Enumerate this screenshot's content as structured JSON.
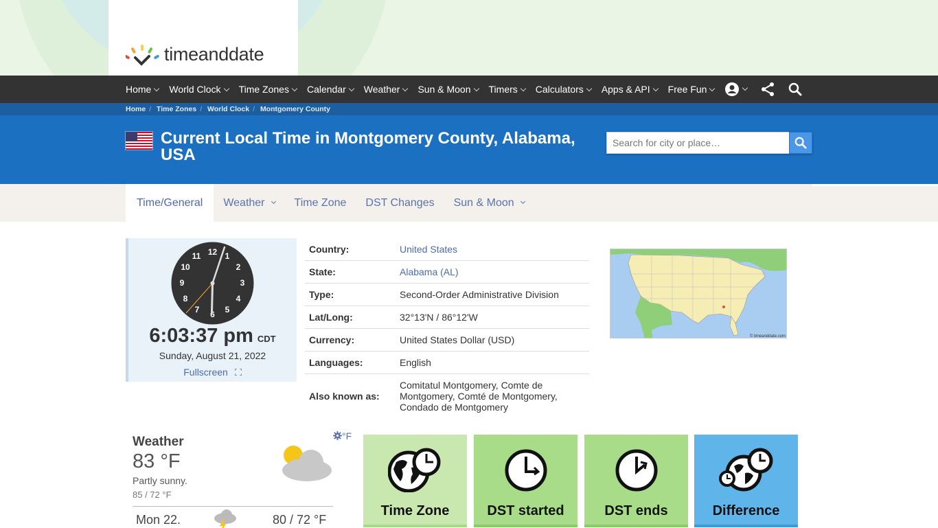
{
  "brand": {
    "name": "timeanddate"
  },
  "nav": {
    "items": [
      "Home",
      "World Clock",
      "Time Zones",
      "Calendar",
      "Weather",
      "Sun & Moon",
      "Timers",
      "Calculators",
      "Apps & API",
      "Free Fun"
    ],
    "icons": [
      "account-icon",
      "share-icon",
      "search-icon"
    ]
  },
  "breadcrumb": [
    "Home",
    "Time Zones",
    "World Clock",
    "Montgomery County"
  ],
  "header": {
    "title": "Current Local Time in Montgomery County, Alabama, USA",
    "search_placeholder": "Search for city or place…",
    "accent": "#1c70c1"
  },
  "tabs": [
    {
      "label": "Time/General",
      "active": true,
      "dropdown": false
    },
    {
      "label": "Weather",
      "active": false,
      "dropdown": true
    },
    {
      "label": "Time Zone",
      "active": false,
      "dropdown": false
    },
    {
      "label": "DST Changes",
      "active": false,
      "dropdown": false
    },
    {
      "label": "Sun & Moon",
      "active": false,
      "dropdown": true
    }
  ],
  "clock": {
    "numbers": [
      "12",
      "1",
      "2",
      "3",
      "4",
      "5",
      "6",
      "7",
      "8",
      "9",
      "10",
      "11"
    ],
    "time": "6:03:37 pm",
    "zone": "CDT",
    "date": "Sunday, August 21, 2022",
    "fullscreen": "Fullscreen"
  },
  "info": [
    {
      "key": "Country:",
      "value": "United States",
      "link": true
    },
    {
      "key": "State:",
      "value": "Alabama (AL)",
      "link": true
    },
    {
      "key": "Type:",
      "value": "Second-Order Administrative Division",
      "link": false
    },
    {
      "key": "Lat/Long:",
      "value": "32°13'N / 86°12'W",
      "link": false
    },
    {
      "key": "Currency:",
      "value": "United States Dollar (USD)",
      "link": false
    },
    {
      "key": "Languages:",
      "value": "English",
      "link": false
    },
    {
      "key": "Also known as:",
      "value": "Comitatul Montgomery, Comte de Montgomery, Comté de Montgomery, Condado de Montgomery",
      "link": false
    }
  ],
  "map": {
    "credit": "© timeanddate.com"
  },
  "weather": {
    "title": "Weather",
    "temp": "83 °F",
    "desc": "Partly sunny.",
    "range": "85 / 72 °F",
    "unit": "°F",
    "forecast_day": "Mon 22.",
    "forecast_temp": "80 / 72 °F"
  },
  "tiles": [
    {
      "label": "Time Zone",
      "bg": "#c8e8b0",
      "bar": "#a9d98a"
    },
    {
      "label": "DST started",
      "bg": "#a8dc88",
      "bar": "#8cc96a"
    },
    {
      "label": "DST ends",
      "bg": "#a8dc88",
      "bar": "#8cc96a"
    },
    {
      "label": "Difference",
      "bg": "#5fb4ea",
      "bar": "#3d9ad6"
    }
  ]
}
